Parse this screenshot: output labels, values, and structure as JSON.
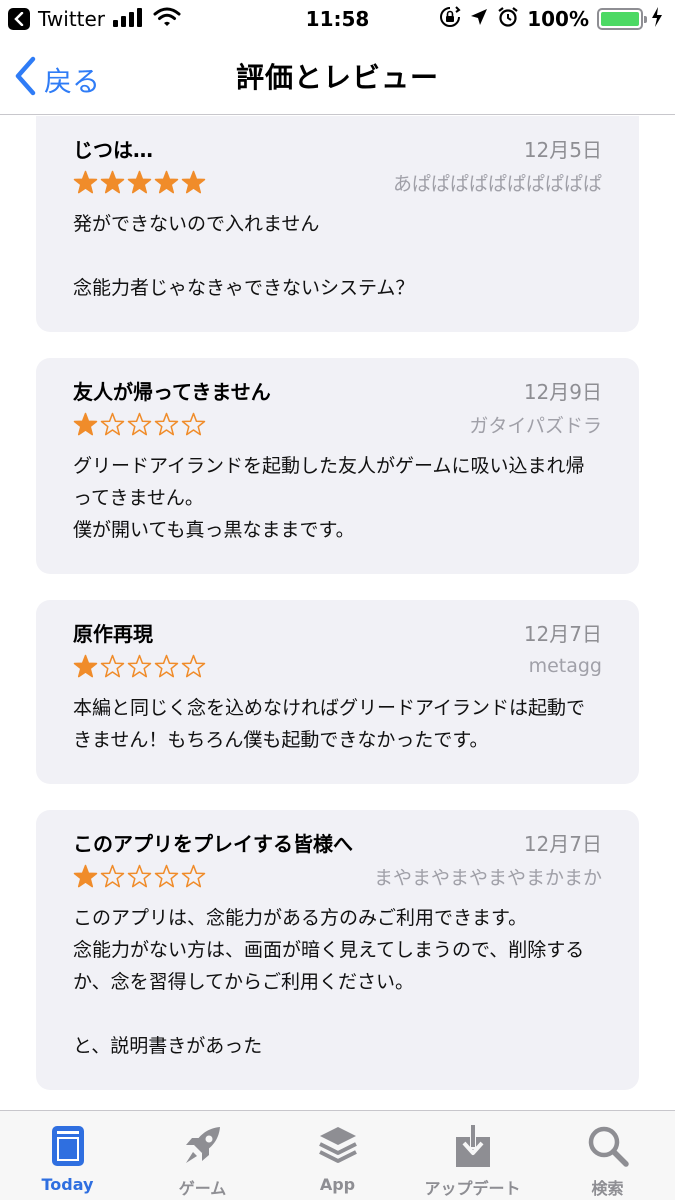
{
  "status_bar": {
    "app_name": "Twitter",
    "time": "11:58",
    "battery": "100%",
    "battery_level": 1.0
  },
  "nav": {
    "back_label": "戻る",
    "title": "評価とレビュー"
  },
  "colors": {
    "accent": "#2f7cf6",
    "star": "#f08c2a",
    "card_bg": "#f1f1f6"
  },
  "reviews": [
    {
      "title": "じつは…",
      "date": "12月5日",
      "rating": 5,
      "author": "あぱぱぱぱぱぱぱぱぱぱ",
      "body": "発ができないので入れません\n\n念能力者じゃなきゃできないシステム？"
    },
    {
      "title": "友人が帰ってきません",
      "date": "12月9日",
      "rating": 1,
      "author": "ガタイパズドラ",
      "body": "グリードアイランドを起動した友人がゲームに吸い込まれ帰ってきません。\n僕が開いても真っ黒なままです。"
    },
    {
      "title": "原作再現",
      "date": "12月7日",
      "rating": 1,
      "author": "metagg",
      "body": "本編と同じく念を込めなければグリードアイランドは起動できません！もちろん僕も起動できなかったです。"
    },
    {
      "title": "このアプリをプレイする皆様へ",
      "date": "12月7日",
      "rating": 1,
      "author": "まやまやまやまやまかまか",
      "body": "このアプリは、念能力がある方のみご利用できます。\n念能力がない方は、画面が暗く見えてしまうので、削除するか、念を習得してからご利用ください。\n\nと、説明書きがあった"
    }
  ],
  "tabs": [
    {
      "label": "Today",
      "icon": "today-icon",
      "active": true
    },
    {
      "label": "ゲーム",
      "icon": "rocket-icon",
      "active": false
    },
    {
      "label": "App",
      "icon": "apps-stack-icon",
      "active": false
    },
    {
      "label": "アップデート",
      "icon": "updates-download-icon",
      "active": false
    },
    {
      "label": "検索",
      "icon": "search-icon",
      "active": false
    }
  ]
}
